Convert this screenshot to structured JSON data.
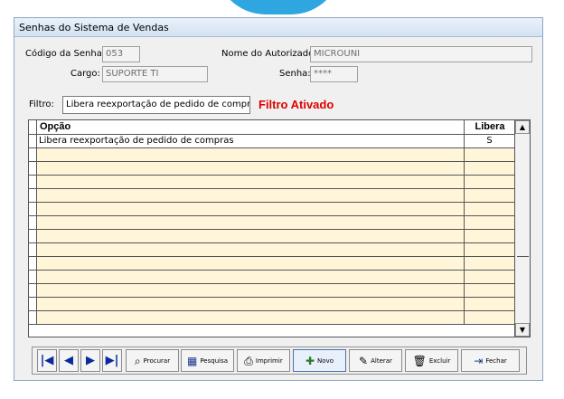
{
  "window": {
    "title": "Senhas do Sistema de Vendas"
  },
  "fields": {
    "codigo_label": "Código da Senha:",
    "codigo_value": "053",
    "nome_label": "Nome do Autorizado:",
    "nome_value": "MICROUNI",
    "cargo_label": "Cargo:",
    "cargo_value": "SUPORTE TI",
    "senha_label": "Senha:",
    "senha_value": "****"
  },
  "filter": {
    "label": "Filtro:",
    "value": "Libera reexportação de pedido de compras",
    "status": "Filtro Ativado",
    "status_color": "#e00000"
  },
  "grid": {
    "columns": [
      "Opção",
      "Libera"
    ],
    "rows": [
      {
        "opcao": "Libera reexportação de pedido de compras",
        "libera": "S"
      }
    ],
    "empty_row_color": "#fff6da"
  },
  "toolbar": {
    "first_icon": "first-record-icon",
    "prev_icon": "previous-record-icon",
    "next_icon": "next-record-icon",
    "last_icon": "last-record-icon",
    "procurar": "Procurar",
    "pesquisa": "Pesquisa",
    "imprimir": "Imprimir",
    "novo": "Novo",
    "alterar": "Alterar",
    "excluir": "Excluir",
    "fechar": "Fechar"
  }
}
